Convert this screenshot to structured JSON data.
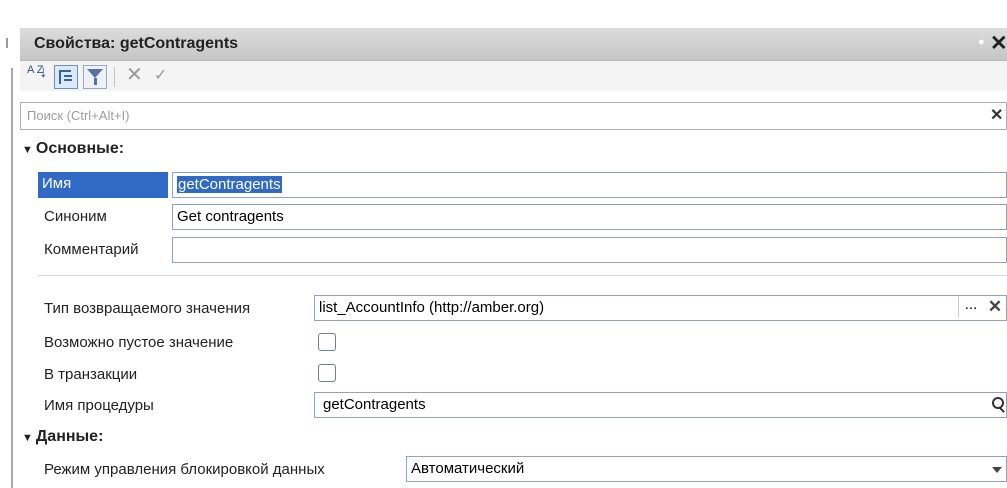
{
  "window": {
    "title": "Свойства: getContragents"
  },
  "toolbar": {
    "sort_icon_text": "A Z",
    "cancel_glyph": "✕",
    "ok_glyph": "✓"
  },
  "search": {
    "placeholder": "Поиск (Ctrl+Alt+I)",
    "value": ""
  },
  "groups": {
    "main": {
      "label": "Основные:",
      "fields": [
        {
          "label": "Имя",
          "value": "getContragents"
        },
        {
          "label": "Синоним",
          "value": "Get contragents"
        },
        {
          "label": "Комментарий",
          "value": ""
        },
        {
          "label": "Тип возвращаемого значения",
          "value": "list_AccountInfo (http://amber.org)",
          "button": "..."
        },
        {
          "label": "Возможно пустое значение",
          "checked": false
        },
        {
          "label": "В транзакции",
          "checked": false
        },
        {
          "label": "Имя процедуры",
          "value": "getContragents"
        }
      ]
    },
    "data": {
      "label": "Данные:",
      "fields": [
        {
          "label": "Режим управления блокировкой данных",
          "value": "Автоматический"
        }
      ]
    }
  },
  "colors": {
    "selection": "#316ac5",
    "titlebar": "#d0d0d0"
  }
}
